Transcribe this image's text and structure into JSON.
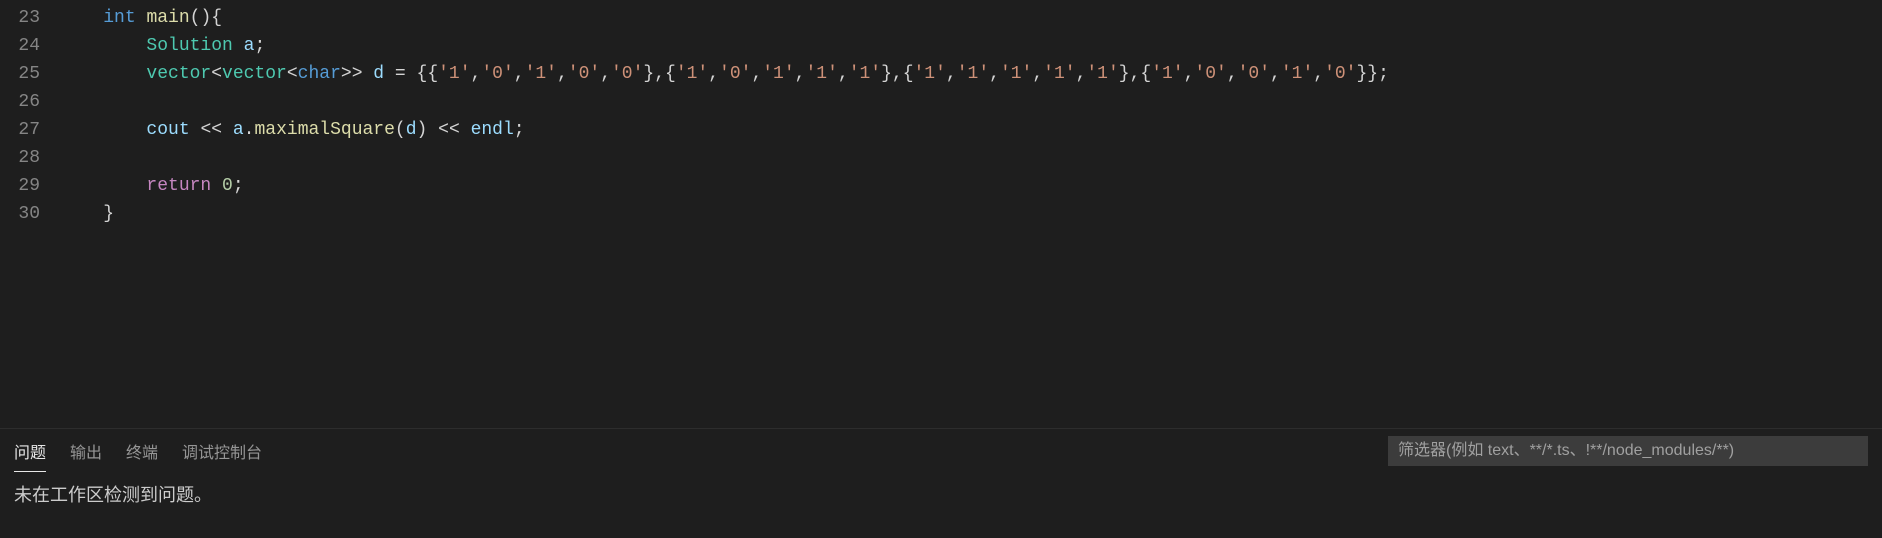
{
  "editor": {
    "lineNumbers": [
      "23",
      "24",
      "25",
      "26",
      "27",
      "28",
      "29",
      "30"
    ],
    "tokensByLine": [
      [
        {
          "cls": "",
          "txt": "    "
        },
        {
          "cls": "tk-type",
          "txt": "int"
        },
        {
          "cls": "",
          "txt": " "
        },
        {
          "cls": "tk-func",
          "txt": "main"
        },
        {
          "cls": "tk-punct",
          "txt": "(){"
        }
      ],
      [
        {
          "cls": "",
          "txt": "        "
        },
        {
          "cls": "tk-class",
          "txt": "Solution"
        },
        {
          "cls": "",
          "txt": " "
        },
        {
          "cls": "tk-var",
          "txt": "a"
        },
        {
          "cls": "tk-punct",
          "txt": ";"
        }
      ],
      [
        {
          "cls": "",
          "txt": "        "
        },
        {
          "cls": "tk-class",
          "txt": "vector"
        },
        {
          "cls": "tk-punct",
          "txt": "<"
        },
        {
          "cls": "tk-class",
          "txt": "vector"
        },
        {
          "cls": "tk-punct",
          "txt": "<"
        },
        {
          "cls": "tk-type",
          "txt": "char"
        },
        {
          "cls": "tk-punct",
          "txt": ">> "
        },
        {
          "cls": "tk-var",
          "txt": "d"
        },
        {
          "cls": "tk-op",
          "txt": " = "
        },
        {
          "cls": "tk-punct",
          "txt": "{{"
        },
        {
          "cls": "tk-string",
          "txt": "'1'"
        },
        {
          "cls": "tk-punct",
          "txt": ","
        },
        {
          "cls": "tk-string",
          "txt": "'0'"
        },
        {
          "cls": "tk-punct",
          "txt": ","
        },
        {
          "cls": "tk-string",
          "txt": "'1'"
        },
        {
          "cls": "tk-punct",
          "txt": ","
        },
        {
          "cls": "tk-string",
          "txt": "'0'"
        },
        {
          "cls": "tk-punct",
          "txt": ","
        },
        {
          "cls": "tk-string",
          "txt": "'0'"
        },
        {
          "cls": "tk-punct",
          "txt": "},{"
        },
        {
          "cls": "tk-string",
          "txt": "'1'"
        },
        {
          "cls": "tk-punct",
          "txt": ","
        },
        {
          "cls": "tk-string",
          "txt": "'0'"
        },
        {
          "cls": "tk-punct",
          "txt": ","
        },
        {
          "cls": "tk-string",
          "txt": "'1'"
        },
        {
          "cls": "tk-punct",
          "txt": ","
        },
        {
          "cls": "tk-string",
          "txt": "'1'"
        },
        {
          "cls": "tk-punct",
          "txt": ","
        },
        {
          "cls": "tk-string",
          "txt": "'1'"
        },
        {
          "cls": "tk-punct",
          "txt": "},{"
        },
        {
          "cls": "tk-string",
          "txt": "'1'"
        },
        {
          "cls": "tk-punct",
          "txt": ","
        },
        {
          "cls": "tk-string",
          "txt": "'1'"
        },
        {
          "cls": "tk-punct",
          "txt": ","
        },
        {
          "cls": "tk-string",
          "txt": "'1'"
        },
        {
          "cls": "tk-punct",
          "txt": ","
        },
        {
          "cls": "tk-string",
          "txt": "'1'"
        },
        {
          "cls": "tk-punct",
          "txt": ","
        },
        {
          "cls": "tk-string",
          "txt": "'1'"
        },
        {
          "cls": "tk-punct",
          "txt": "},{"
        },
        {
          "cls": "tk-string",
          "txt": "'1'"
        },
        {
          "cls": "tk-punct",
          "txt": ","
        },
        {
          "cls": "tk-string",
          "txt": "'0'"
        },
        {
          "cls": "tk-punct",
          "txt": ","
        },
        {
          "cls": "tk-string",
          "txt": "'0'"
        },
        {
          "cls": "tk-punct",
          "txt": ","
        },
        {
          "cls": "tk-string",
          "txt": "'1'"
        },
        {
          "cls": "tk-punct",
          "txt": ","
        },
        {
          "cls": "tk-string",
          "txt": "'0'"
        },
        {
          "cls": "tk-punct",
          "txt": "}};"
        }
      ],
      [],
      [
        {
          "cls": "",
          "txt": "        "
        },
        {
          "cls": "tk-var",
          "txt": "cout"
        },
        {
          "cls": "tk-op",
          "txt": " << "
        },
        {
          "cls": "tk-var",
          "txt": "a"
        },
        {
          "cls": "tk-punct",
          "txt": "."
        },
        {
          "cls": "tk-func",
          "txt": "maximalSquare"
        },
        {
          "cls": "tk-punct",
          "txt": "("
        },
        {
          "cls": "tk-var",
          "txt": "d"
        },
        {
          "cls": "tk-punct",
          "txt": ")"
        },
        {
          "cls": "tk-op",
          "txt": " << "
        },
        {
          "cls": "tk-var",
          "txt": "endl"
        },
        {
          "cls": "tk-punct",
          "txt": ";"
        }
      ],
      [],
      [
        {
          "cls": "",
          "txt": "        "
        },
        {
          "cls": "tk-keyword",
          "txt": "return"
        },
        {
          "cls": "",
          "txt": " "
        },
        {
          "cls": "tk-number",
          "txt": "0"
        },
        {
          "cls": "tk-punct",
          "txt": ";"
        }
      ],
      [
        {
          "cls": "",
          "txt": "    "
        },
        {
          "cls": "tk-punct",
          "txt": "}"
        }
      ]
    ]
  },
  "panel": {
    "tabs": [
      {
        "label": "问题",
        "active": true
      },
      {
        "label": "输出",
        "active": false
      },
      {
        "label": "终端",
        "active": false
      },
      {
        "label": "调试控制台",
        "active": false
      }
    ],
    "filterPlaceholder": "筛选器(例如 text、**/*.ts、!**/node_modules/**)",
    "message": "未在工作区检测到问题。"
  }
}
